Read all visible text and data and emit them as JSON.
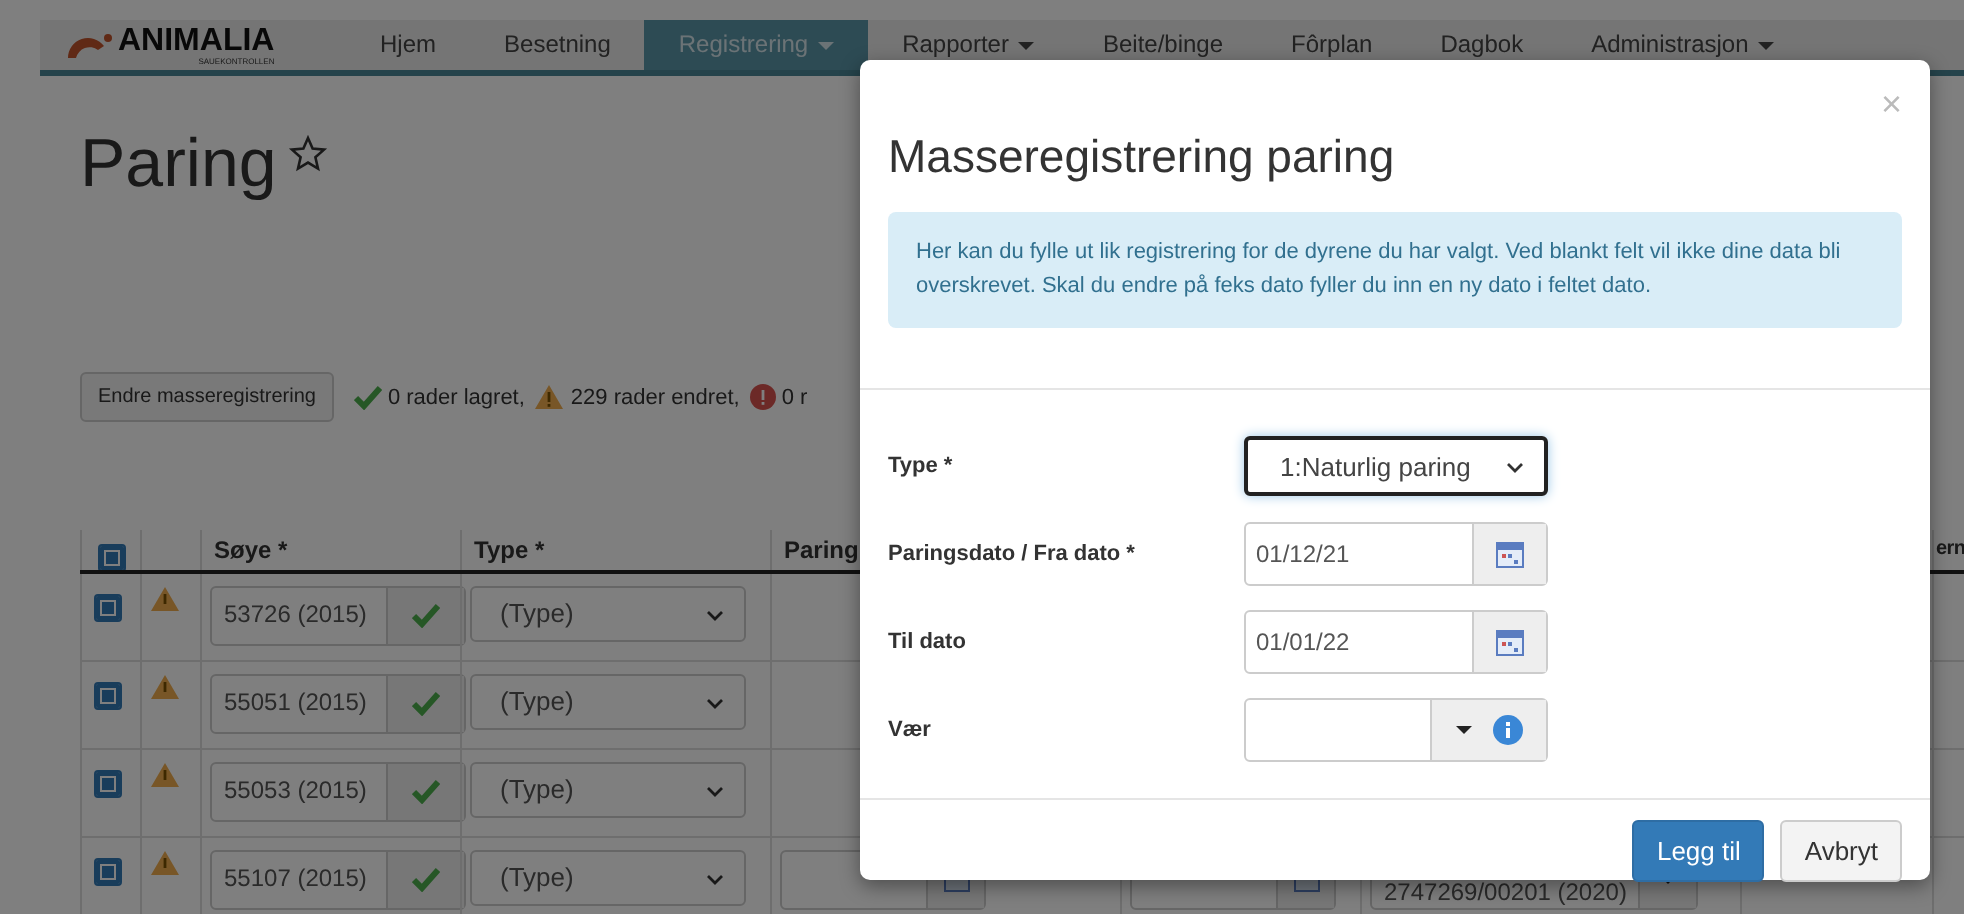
{
  "nav": {
    "logo": "ANIMALIA",
    "logo_sub": "SAUEKONTROLLEN",
    "items": [
      {
        "label": "Hjem",
        "selected": false,
        "dropdown": false
      },
      {
        "label": "Besetning",
        "selected": false,
        "dropdown": false
      },
      {
        "label": "Registrering",
        "selected": true,
        "dropdown": true
      },
      {
        "label": "Rapporter",
        "selected": false,
        "dropdown": true
      },
      {
        "label": "Beite/binge",
        "selected": false,
        "dropdown": false
      },
      {
        "label": "Fôrplan",
        "selected": false,
        "dropdown": false
      },
      {
        "label": "Dagbok",
        "selected": false,
        "dropdown": false
      },
      {
        "label": "Administrasjon",
        "selected": false,
        "dropdown": true
      }
    ]
  },
  "page": {
    "title": "Paring"
  },
  "toolbar": {
    "button": "Endre masseregistrering",
    "status": [
      {
        "kind": "ok",
        "text": "0 rader lagret,"
      },
      {
        "kind": "warning",
        "text": "229 rader endret,"
      },
      {
        "kind": "error",
        "text": "0 r"
      }
    ]
  },
  "table": {
    "select_all": true,
    "columns": [
      "Søye *",
      "Type *",
      "Paring",
      "ern"
    ],
    "rows": [
      {
        "checked": true,
        "warning": true,
        "ewe": "53726 (2015)",
        "type": "(Type)"
      },
      {
        "checked": true,
        "warning": true,
        "ewe": "55051 (2015)",
        "type": "(Type)"
      },
      {
        "checked": true,
        "warning": true,
        "ewe": "55053 (2015)",
        "type": "(Type)"
      },
      {
        "checked": true,
        "warning": true,
        "ewe": "55107 (2015)",
        "type": "(Type)",
        "ram": "2747269/00201 (2020)"
      }
    ]
  },
  "modal": {
    "title": "Masseregistrering paring",
    "close": "×",
    "info": "Her kan du fylle ut lik registrering for de dyrene du har valgt. Ved blankt felt vil ikke dine data bli overskrevet. Skal du endre på feks dato fyller du inn en ny dato i feltet dato.",
    "fields": [
      {
        "kind": "select",
        "label": "Type *",
        "value": "1:Naturlig paring",
        "focused": true
      },
      {
        "kind": "date",
        "label": "Paringsdato / Fra dato *",
        "value": "01/12/21"
      },
      {
        "kind": "date",
        "label": "Til dato",
        "value": "01/01/22"
      },
      {
        "kind": "combo",
        "label": "Vær"
      }
    ],
    "buttons": [
      {
        "label": "Legg til",
        "primary": true
      },
      {
        "label": "Avbryt",
        "primary": false
      }
    ]
  }
}
